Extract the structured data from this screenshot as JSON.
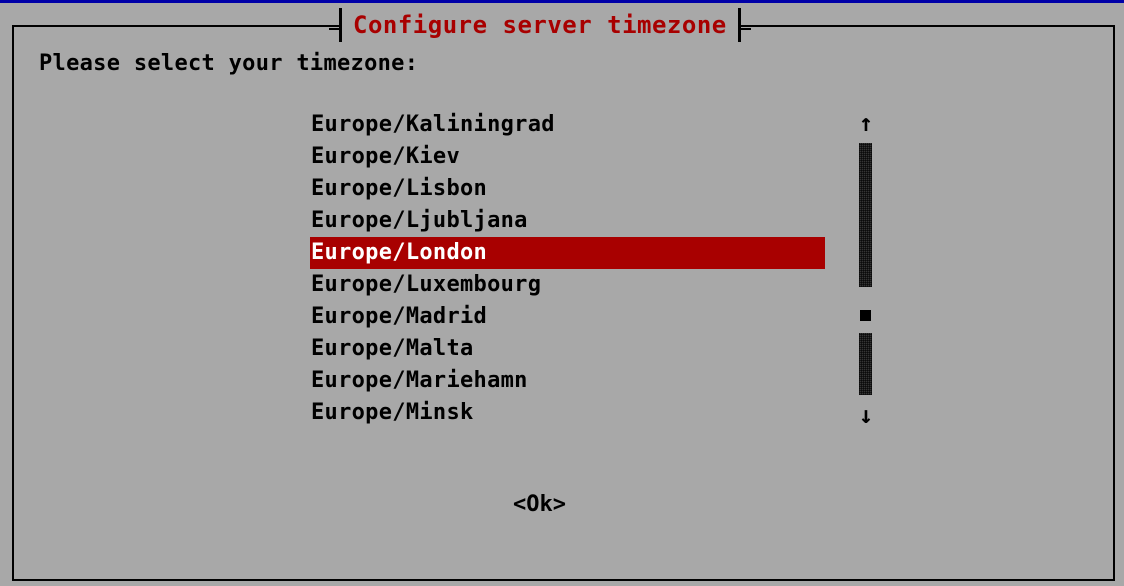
{
  "dialog": {
    "title": "Configure server timezone",
    "prompt": "Please select your timezone:",
    "ok_label": "<Ok>"
  },
  "timezone_list": {
    "items": [
      {
        "label": "Europe/Kaliningrad",
        "selected": false
      },
      {
        "label": "Europe/Kiev",
        "selected": false
      },
      {
        "label": "Europe/Lisbon",
        "selected": false
      },
      {
        "label": "Europe/Ljubljana",
        "selected": false
      },
      {
        "label": "Europe/London",
        "selected": true
      },
      {
        "label": "Europe/Luxembourg",
        "selected": false
      },
      {
        "label": "Europe/Madrid",
        "selected": false
      },
      {
        "label": "Europe/Malta",
        "selected": false
      },
      {
        "label": "Europe/Mariehamn",
        "selected": false
      },
      {
        "label": "Europe/Minsk",
        "selected": false
      }
    ]
  },
  "scrollbar": {
    "up_symbol": "↑",
    "down_symbol": "↓"
  },
  "colors": {
    "background": "#a8a8a8",
    "highlight": "#a80000",
    "title_text": "#a80000",
    "top_border": "#0000a8"
  }
}
